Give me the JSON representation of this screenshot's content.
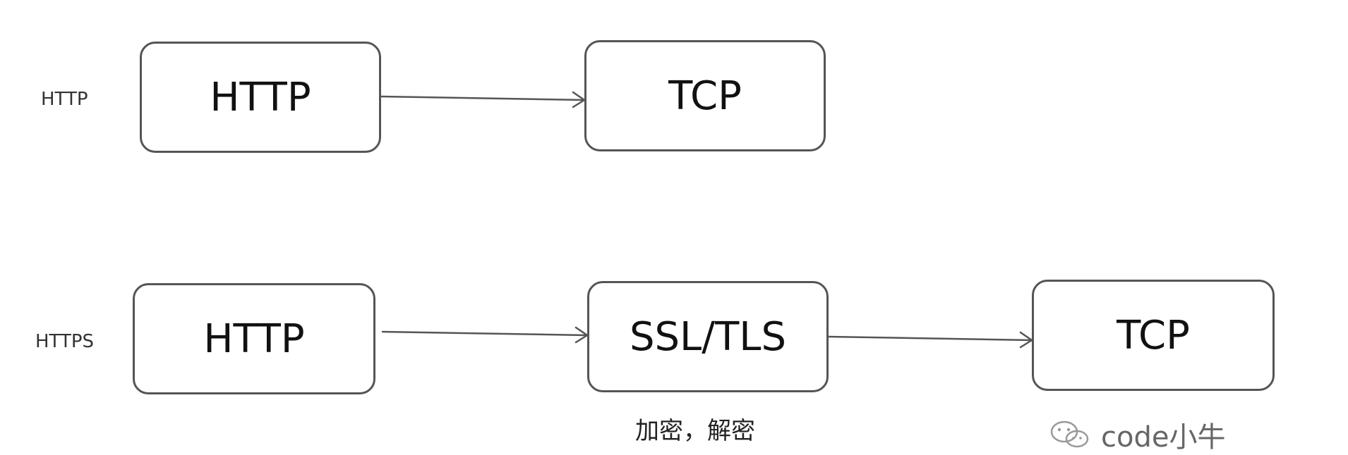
{
  "rows": [
    {
      "label": "HTTP",
      "boxes": [
        "HTTP",
        "TCP"
      ]
    },
    {
      "label": "HTTPS",
      "boxes": [
        "HTTP",
        "SSL/TLS",
        "TCP"
      ],
      "caption": "加密，解密"
    }
  ],
  "watermark": {
    "icon": "wechat-icon",
    "text": "code小牛"
  }
}
